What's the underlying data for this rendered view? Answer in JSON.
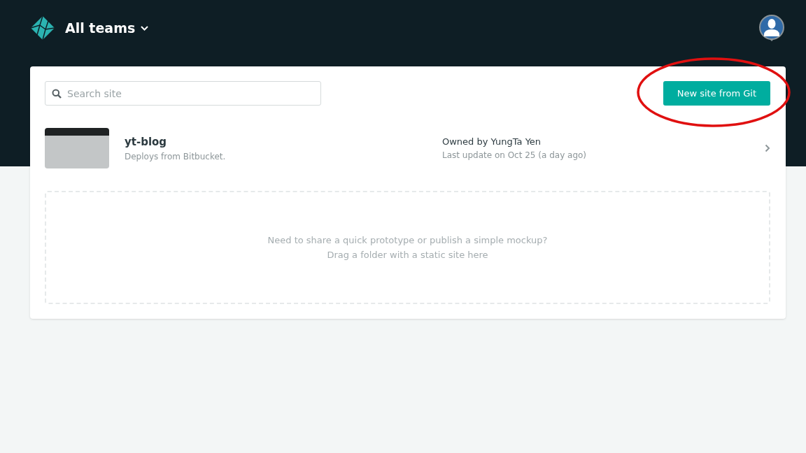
{
  "header": {
    "team_menu": "All teams"
  },
  "search": {
    "placeholder": "Search site"
  },
  "primary_button": "New site from Git",
  "sites": [
    {
      "name": "yt-blog",
      "source": "Deploys from Bitbucket.",
      "owner": "Owned by YungTa Yen",
      "updated": "Last update on Oct 25 (a day ago)"
    }
  ],
  "drop_zone": {
    "lines": [
      "Need to share a quick prototype or publish a simple mockup?",
      "Drag a folder with a static site here"
    ]
  }
}
